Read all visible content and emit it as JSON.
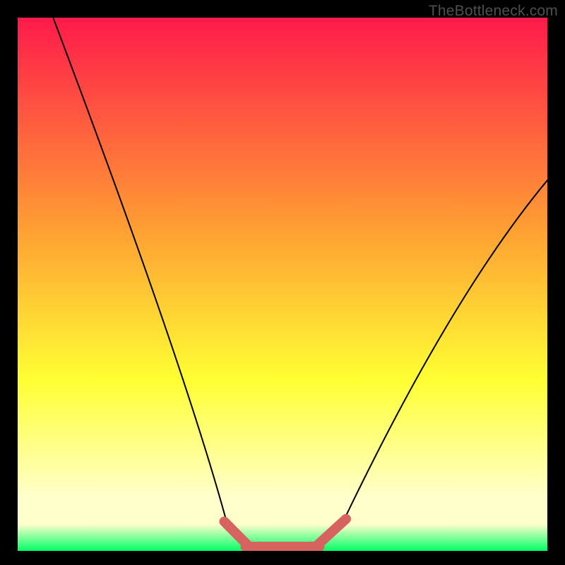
{
  "watermark": "TheBottleneck.com",
  "colors": {
    "frame": "#000000",
    "grad_top": "#ff1a4a",
    "grad_mid_orange": "#ffa033",
    "grad_mid_yellow": "#ffff33",
    "grad_pale_yellow": "#ffffcc",
    "grad_green": "#00ff66",
    "curve": "#000000",
    "band": "#d6635f"
  },
  "chart_data": {
    "type": "line",
    "title": "",
    "xlabel": "",
    "ylabel": "",
    "xlim": [
      0,
      1
    ],
    "ylim": [
      0,
      1
    ],
    "x": [
      0.0,
      0.05,
      0.1,
      0.15,
      0.2,
      0.25,
      0.3,
      0.35,
      0.38,
      0.4,
      0.42,
      0.45,
      0.5,
      0.55,
      0.58,
      0.6,
      0.62,
      0.65,
      0.7,
      0.75,
      0.8,
      0.85,
      0.9,
      0.95,
      1.0
    ],
    "series": [
      {
        "name": "bottleneck-curve",
        "values": [
          1.0,
          0.88,
          0.75,
          0.63,
          0.5,
          0.38,
          0.25,
          0.13,
          0.06,
          0.03,
          0.015,
          0.005,
          0.0,
          0.005,
          0.015,
          0.03,
          0.06,
          0.12,
          0.22,
          0.32,
          0.42,
          0.51,
          0.58,
          0.64,
          0.7
        ]
      }
    ],
    "band_segments": [
      {
        "path": [
          [
            0.39,
            0.055
          ],
          [
            0.435,
            0.01
          ]
        ]
      },
      {
        "path": [
          [
            0.565,
            0.01
          ],
          [
            0.62,
            0.06
          ]
        ]
      },
      {
        "path": [
          [
            0.43,
            0.008
          ],
          [
            0.57,
            0.008
          ]
        ]
      }
    ],
    "curve_segments": {
      "left": {
        "start": [
          0.067,
          1.0
        ],
        "control": [
          0.31,
          0.36
        ],
        "end": [
          0.393,
          0.06
        ]
      },
      "right": {
        "start": [
          0.617,
          0.06
        ],
        "control": [
          0.82,
          0.48
        ],
        "end": [
          1.0,
          0.695
        ]
      }
    }
  }
}
